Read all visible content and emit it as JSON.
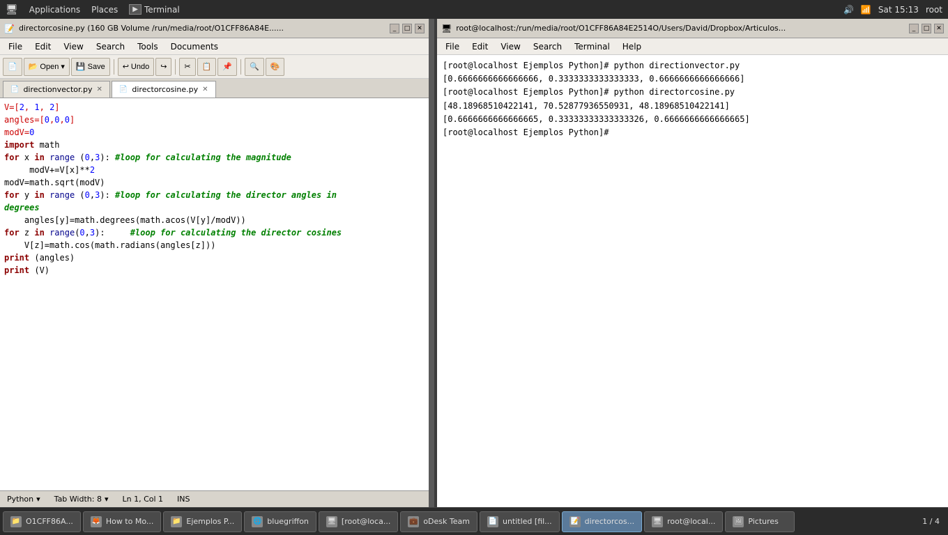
{
  "topbar": {
    "applications": "Applications",
    "places": "Places",
    "terminal_title": "Terminal",
    "time": "Sat 15:13",
    "user": "root"
  },
  "editor": {
    "titlebar_title": "directorcosine.py (160 GB Volume /run/media/root/O1CFF86A84E......",
    "menu_items": [
      "File",
      "Edit",
      "View",
      "Search",
      "Tools",
      "Documents"
    ],
    "toolbar_buttons": [
      "New",
      "Open",
      "Save",
      "Undo",
      "Redo",
      "Cut",
      "Copy",
      "Paste",
      "Find",
      "Color"
    ],
    "tab1_label": "directionvector.py",
    "tab2_label": "directorcosine.py",
    "code": "V=[2, 1, 2]\nangles=[0,0,0]\nmodV=0\nimport math\nfor x in range (0,3): #loop for calculating the magnitude\n     modV+=V[x]**2\nmodV=math.sqrt(modV)\nfor y in range (0,3): #loop for calculating the director angles in degrees\n    angles[y]=math.degrees(math.acos(V[y]/modV))\nfor z in range(0,3):     #loop for calculating the director cosines\n    V[z]=math.cos(math.radians(angles[z]))\nprint (angles)\nprint (V)",
    "status_lang": "Python",
    "status_tab": "Tab Width: 8",
    "status_pos": "Ln 1, Col 1",
    "status_ins": "INS"
  },
  "terminal": {
    "titlebar_title": "root@localhost:/run/media/root/O1CFF86A84E2514O/Users/David/Dropbox/Articulos...",
    "menu_items": [
      "File",
      "Edit",
      "View",
      "Search",
      "Terminal",
      "Help"
    ],
    "output_lines": [
      "[root@localhost Ejemplos Python]# python directionvector.py",
      "[0.6666666666666666, 0.3333333333333333, 0.6666666666666666]",
      "[root@localhost Ejemplos Python]# python directorcosine.py",
      "[48.18968510422141, 70.52877936550931, 48.18968510422141]",
      "[0.6666666666666665, 0.33333333333333326, 0.6666666666666665]",
      "[root@localhost Ejemplos Python]# "
    ]
  },
  "taskbar": {
    "items": [
      {
        "label": "O1CFF86A...",
        "icon": "📁",
        "active": false
      },
      {
        "label": "How to Mo...",
        "icon": "🦊",
        "active": false
      },
      {
        "label": "Ejemplos P...",
        "icon": "📁",
        "active": false
      },
      {
        "label": "bluegriffon",
        "icon": "🌐",
        "active": false
      },
      {
        "label": "[root@loca...",
        "icon": "🖥",
        "active": false
      },
      {
        "label": "oDesk Team",
        "icon": "💼",
        "active": false
      },
      {
        "label": "untitled [fil...",
        "icon": "📄",
        "active": false
      },
      {
        "label": "directorcos...",
        "icon": "📝",
        "active": true
      },
      {
        "label": "root@local...",
        "icon": "🖥",
        "active": false
      },
      {
        "label": "Pictures",
        "icon": "🖼",
        "active": false
      }
    ],
    "pager": "1 / 4"
  }
}
